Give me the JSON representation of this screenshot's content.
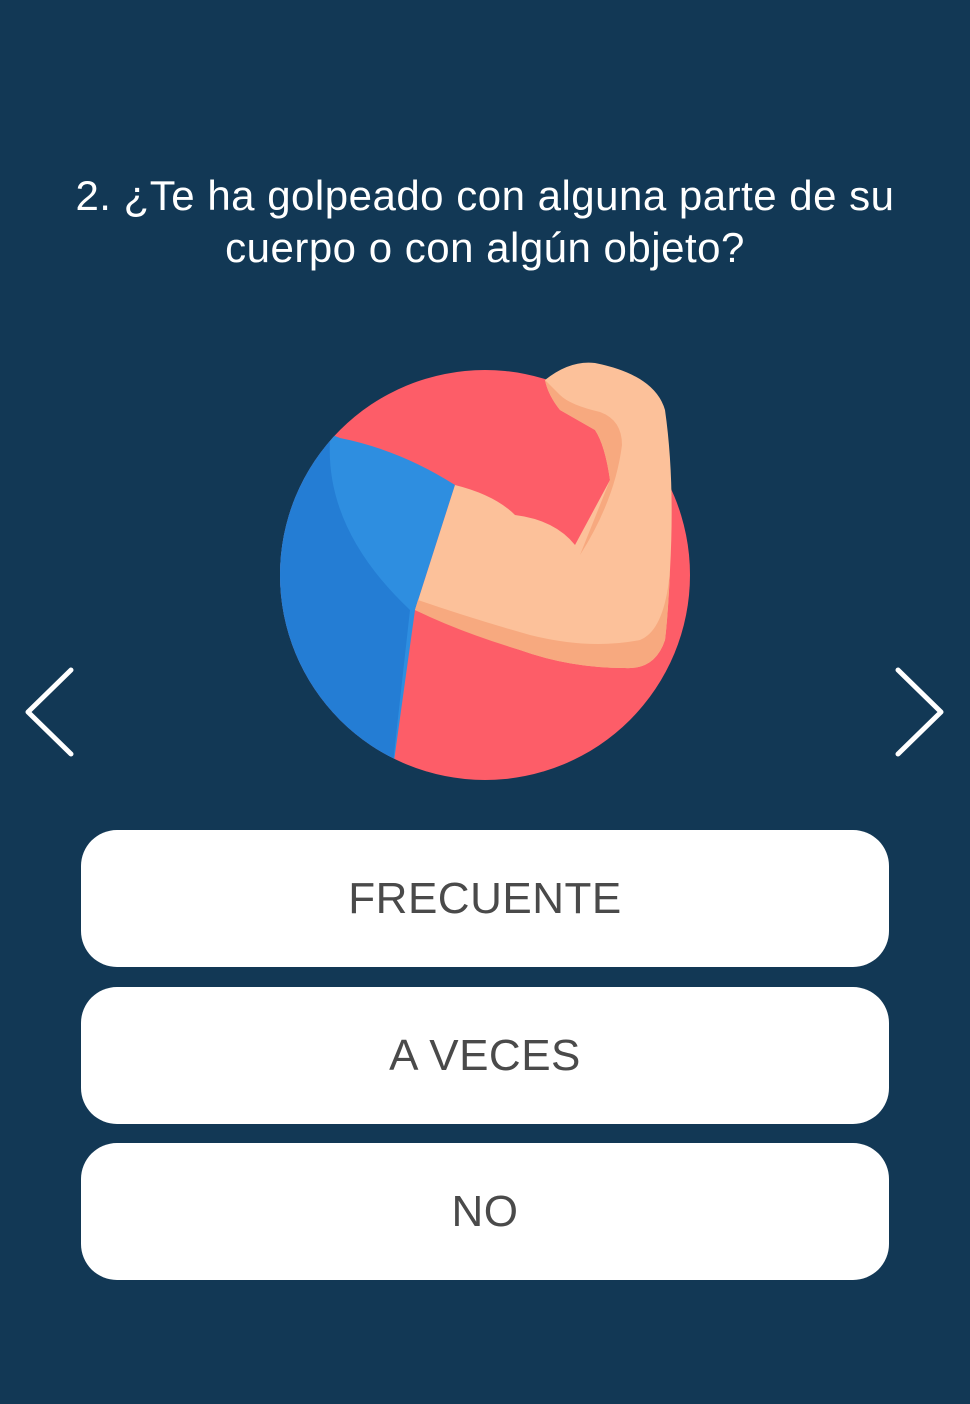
{
  "question": {
    "text": "2. ¿Te ha golpeado con alguna parte de su cuerpo o con algún objeto?"
  },
  "illustration": {
    "icon": "flexed-arm-icon",
    "colors": {
      "circle": "#fd5d68",
      "sleeve_light": "#2e8ee0",
      "sleeve_dark": "#247dd4",
      "skin": "#fcc19a",
      "skin_shadow": "#f7a97f"
    }
  },
  "navigation": {
    "prev_icon": "chevron-left-icon",
    "next_icon": "chevron-right-icon"
  },
  "answers": [
    {
      "label": "FRECUENTE"
    },
    {
      "label": "A VECES"
    },
    {
      "label": "NO"
    }
  ],
  "colors": {
    "background": "#123855",
    "button_bg": "#ffffff",
    "button_text": "#4a4a4a",
    "question_text": "#ffffff"
  }
}
